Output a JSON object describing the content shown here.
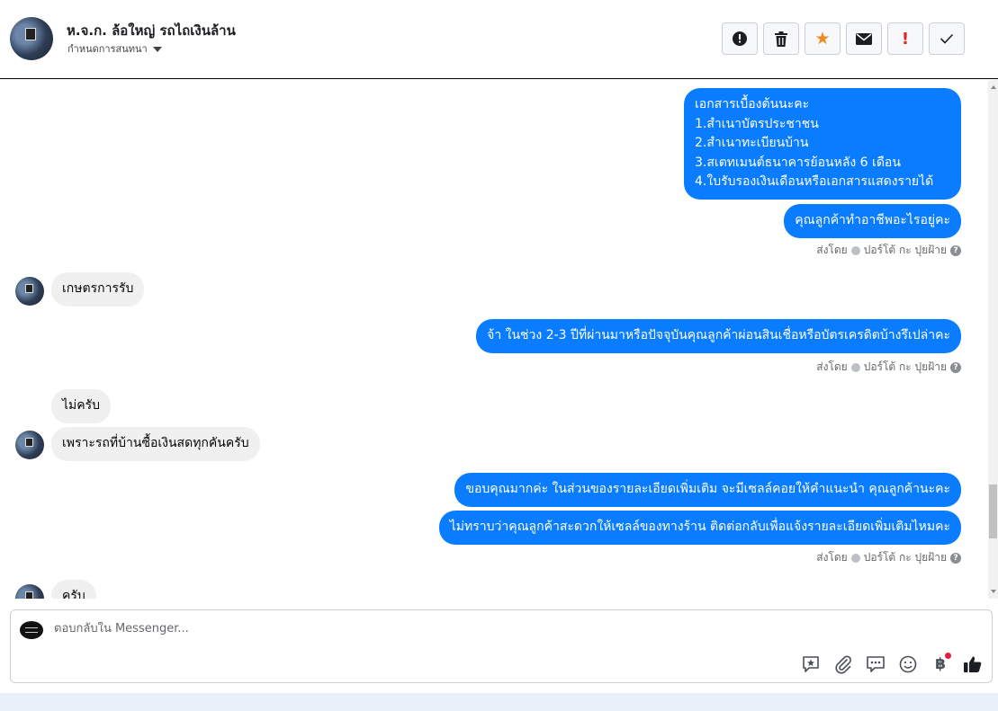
{
  "header": {
    "title": "ห.จ.ก. ล้อใหญ่ รถไถเงินล้าน",
    "subtitle": "กำหนดการสนทนา"
  },
  "toolbar": {
    "buttons": [
      {
        "name": "alert-circle",
        "glyph": "⏺"
      },
      {
        "name": "trash",
        "glyph": "🗑"
      },
      {
        "name": "star",
        "glyph": "★"
      },
      {
        "name": "envelope",
        "glyph": "✉"
      },
      {
        "name": "exclamation",
        "glyph": "!"
      },
      {
        "name": "check",
        "glyph": "✓"
      }
    ]
  },
  "messages": {
    "m1": "เอกสารเบื้องต้นนะคะ\n1.สำเนาบัตรประชาชน\n2.สำเนาทะเบียนบ้าน\n3.สเตทเมนต์ธนาคารย้อนหลัง 6 เดือน\n4.ใบรับรองเงินเดือนหรือเอกสารแสดงรายได้",
    "m2": "คุณลูกค้าทำอาชีพอะไรอยู่คะ",
    "m3": "เกษตรการรับ",
    "m4": "จ้า ในช่วง 2-3 ปีที่ผ่านมาหรือปัจจุบันคุณลูกค้าผ่อนสินเชื่อหรือบัตรเครดิตบ้างรึเปล่าคะ",
    "m5": "ไม่ครับ",
    "m6": "เพราะรถที่บ้านซื้อเงินสดทุกคันครับ",
    "m7": "ขอบคุณมากค่ะ  ในส่วนของรายละเอียดเพิ่มเติม จะมีเซลล์คอยให้คำแนะนำ คุณลูกค้านะคะ",
    "m8": "ไม่ทราบว่าคุณลูกค้าสะดวกให้เซลล์ของทางร้าน ติดต่อกลับเพื่อแจ้งรายละเอียดเพิ่มเติมไหมคะ",
    "m9": "ครับ"
  },
  "sent_by": {
    "prefix": "ส่งโดย",
    "name": "ปอร์โต้ กะ ปุยฝ้าย",
    "help": "?"
  },
  "composer": {
    "placeholder": "ตอบกลับใน Messenger...",
    "icons": [
      "reply-star-icon",
      "paperclip-icon",
      "chat-bubbles-icon",
      "emoji-icon",
      "baht-icon",
      "thumbs-up-icon"
    ],
    "baht_glyph": "฿"
  },
  "colors": {
    "outgoing_bubble": "#0a7cff",
    "incoming_bubble": "#f0f0f0",
    "star": "#f08a24",
    "warning": "#e4231d"
  }
}
